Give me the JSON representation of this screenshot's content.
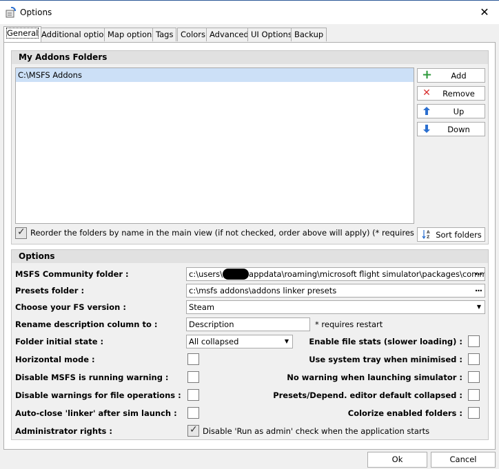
{
  "window": {
    "title": "Options",
    "close_glyph": "✕"
  },
  "tabs": [
    {
      "label": "General",
      "active": true
    },
    {
      "label": "Additional options"
    },
    {
      "label": "Map options"
    },
    {
      "label": "Tags"
    },
    {
      "label": "Colors"
    },
    {
      "label": "Advanced"
    },
    {
      "label": "UI Options"
    },
    {
      "label": "Backup"
    }
  ],
  "addons": {
    "header": "My Addons Folders",
    "folders": [
      "C:\\MSFS Addons"
    ],
    "buttons": {
      "add": {
        "label": "Add",
        "icon": "plus-icon",
        "glyph": "+",
        "color": "#2e9a3c"
      },
      "remove": {
        "label": "Remove",
        "icon": "x-icon",
        "glyph": "✕",
        "color": "#d93030"
      },
      "up": {
        "label": "Up",
        "icon": "arrow-up-icon",
        "glyph": "🡅",
        "color": "#2b6fcf"
      },
      "down": {
        "label": "Down",
        "icon": "arrow-down-icon",
        "glyph": "🡇",
        "color": "#2b6fcf"
      },
      "sort": {
        "label": "Sort folders",
        "icon": "sort-az-icon"
      }
    },
    "reorder_checked": true,
    "reorder_label": "Reorder the folders by name in the main view (if not checked, order above will apply) (* requires restart)"
  },
  "options": {
    "header": "Options",
    "community_label": "MSFS Community folder :",
    "community_value_pre": "c:\\users\\",
    "community_value_post": "appdata\\roaming\\microsoft flight simulator\\packages\\community",
    "presets_label": "Presets folder :",
    "presets_value": "c:\\msfs addons\\addons linker presets",
    "fs_version_label": "Choose your FS version :",
    "fs_version_value": "Steam",
    "rename_label": "Rename description column to :",
    "rename_value": "Description",
    "rename_note": "* requires restart",
    "folder_state_label": "Folder initial state :",
    "folder_state_value": "All collapsed",
    "file_stats_label": "Enable file stats (slower loading) :",
    "horizontal_label": "Horizontal mode :",
    "system_tray_label": "Use system tray when minimised :",
    "disable_running_label": "Disable MSFS is running warning :",
    "no_warning_launch_label": "No warning when launching simulator :",
    "disable_file_ops_label": "Disable warnings for file operations :",
    "presets_editor_label": "Presets/Depend. editor default collapsed :",
    "auto_close_label": "Auto-close 'linker' after sim launch :",
    "colorize_label": "Colorize enabled folders :",
    "admin_label": "Administrator rights :",
    "admin_checked": true,
    "admin_check_label": "Disable 'Run as admin' check when the application starts"
  },
  "footer": {
    "ok": "Ok",
    "cancel": "Cancel"
  }
}
